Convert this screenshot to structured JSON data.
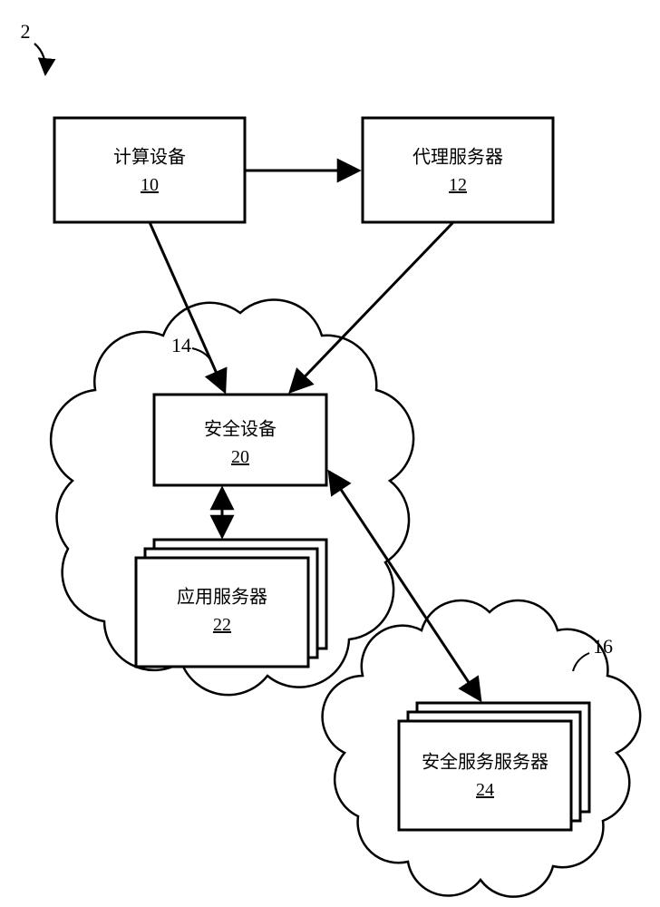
{
  "figure_ref": {
    "label": "2"
  },
  "computing_device": {
    "label": "计算设备",
    "num": "10"
  },
  "proxy_server": {
    "label": "代理服务器",
    "num": "12"
  },
  "cloud_a": {
    "label": "14"
  },
  "cloud_b": {
    "label": "16"
  },
  "security_device": {
    "label": "安全设备",
    "num": "20"
  },
  "app_server": {
    "label": "应用服务器",
    "num": "22"
  },
  "sec_service_srv": {
    "label": "安全服务服务器",
    "num": "24"
  }
}
